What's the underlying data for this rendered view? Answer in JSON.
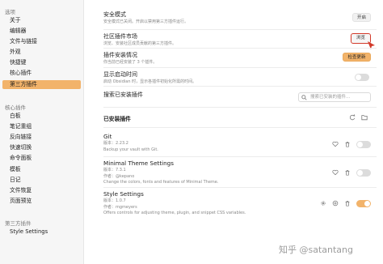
{
  "sidebar": {
    "sections": [
      {
        "heading": "选项",
        "items": [
          "关于",
          "编辑器",
          "文件与链接",
          "外观",
          "快捷键",
          "核心插件",
          "第三方插件"
        ]
      },
      {
        "heading": "核心插件",
        "items": [
          "白板",
          "笔记重组",
          "反向链接",
          "快速切换",
          "命令面板",
          "模板",
          "日记",
          "文件恢复",
          "页面预览"
        ]
      },
      {
        "heading": "第三方插件",
        "items": [
          "Style Settings"
        ]
      }
    ],
    "active_item": "第三方插件"
  },
  "settings": {
    "safe_mode": {
      "title": "安全模式",
      "desc": "安全模式已关闭。开启以禁用第三方插件运行。",
      "button": "开启"
    },
    "community": {
      "title": "社区插件市场",
      "desc": "浏览、安装社区成员贡献的第三方插件。",
      "button": "浏览"
    },
    "updates": {
      "title": "插件安装情况",
      "desc": "你当前已经安装了 3 个插件。",
      "button": "检查更新"
    },
    "debug": {
      "title": "显示启动时间",
      "desc": "启动 Obsidian 时，显示各插件初始化所需的时间。"
    },
    "search": {
      "title": "搜索已安装插件",
      "placeholder": "搜索已安装的插件…"
    }
  },
  "installed": {
    "heading": "已安装插件",
    "plugins": [
      {
        "name": "Git",
        "version": "版本：2.23.2",
        "author": "",
        "desc": "Backup your vault with Git.",
        "enabled": false
      },
      {
        "name": "Minimal Theme Settings",
        "version": "版本：7.3.1",
        "author": "作者：@kepano",
        "desc": "Change the colors, fonts and features of Minimal Theme.",
        "enabled": false
      },
      {
        "name": "Style Settings",
        "version": "版本：1.0.7",
        "author": "作者：mgmeyers",
        "desc": "Offers controls for adjusting theme, plugin, and snippet CSS variables.",
        "enabled": true
      }
    ]
  },
  "watermark": "知乎 @satantang",
  "colors": {
    "accent": "#f2b36a",
    "highlight_border": "#d23a2a"
  }
}
